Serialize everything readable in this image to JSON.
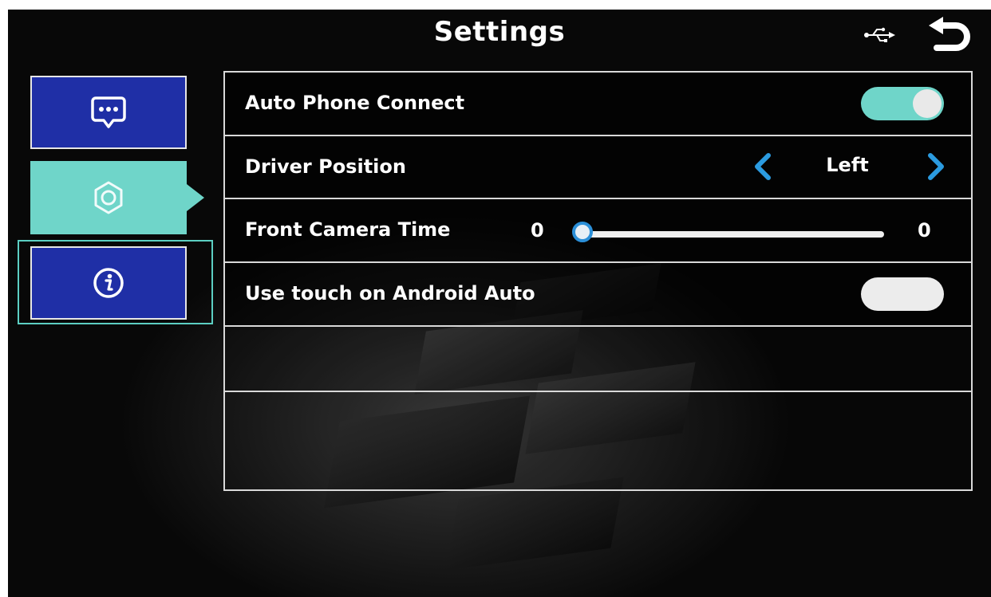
{
  "header": {
    "title": "Settings",
    "usb_icon": "usb-icon",
    "back_icon": "back-arrow-icon"
  },
  "sidebar": {
    "tabs": [
      {
        "id": "messages",
        "icon": "chat-bubble-icon",
        "active": false
      },
      {
        "id": "settings",
        "icon": "gear-icon",
        "active": true
      },
      {
        "id": "info",
        "icon": "info-icon",
        "active": false,
        "focused": true
      }
    ]
  },
  "settings": {
    "auto_phone_connect": {
      "label": "Auto Phone Connect",
      "enabled": true
    },
    "driver_position": {
      "label": "Driver Position",
      "value": "Left"
    },
    "front_camera_time": {
      "label": "Front Camera Time",
      "min_label": "0",
      "value_label": "0",
      "fraction": 0.0
    },
    "use_touch_android_auto": {
      "label": "Use touch on Android Auto",
      "enabled": false
    }
  },
  "colors": {
    "accent": "#6fd5c9",
    "tab_blue": "#1f2fa6",
    "slider_blue": "#2b8fd8",
    "chevron_blue": "#2b9be0",
    "background": "#050505"
  }
}
